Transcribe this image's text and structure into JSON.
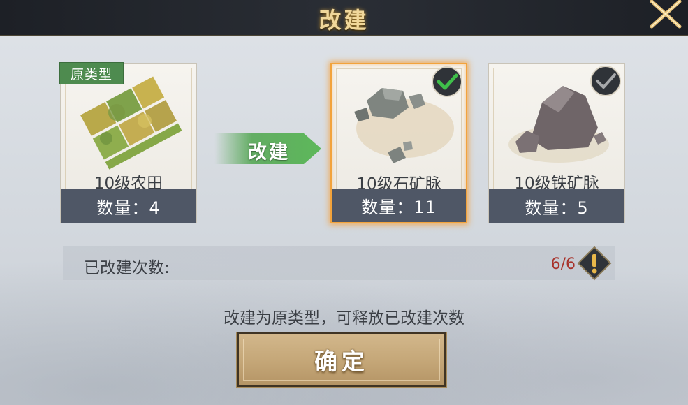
{
  "dialog": {
    "title": "改建"
  },
  "original": {
    "tag": "原类型",
    "name": "10级农田",
    "quantity_text": "数量：4"
  },
  "arrow_label": "改建",
  "options": [
    {
      "name": "10级石矿脉",
      "quantity_text": "数量：11",
      "selected": true
    },
    {
      "name": "10级铁矿脉",
      "quantity_text": "数量：5",
      "selected": false
    }
  ],
  "rebuild_count": {
    "label": "已改建次数:",
    "value": "6/6"
  },
  "hint": "改建为原类型，可释放已改建次数",
  "confirm_label": "确定",
  "colors": {
    "selected_border": "#f2a33c",
    "check_green": "#3fbf4a",
    "count_red": "#a8322a",
    "tag_green": "#4e8b4f"
  }
}
